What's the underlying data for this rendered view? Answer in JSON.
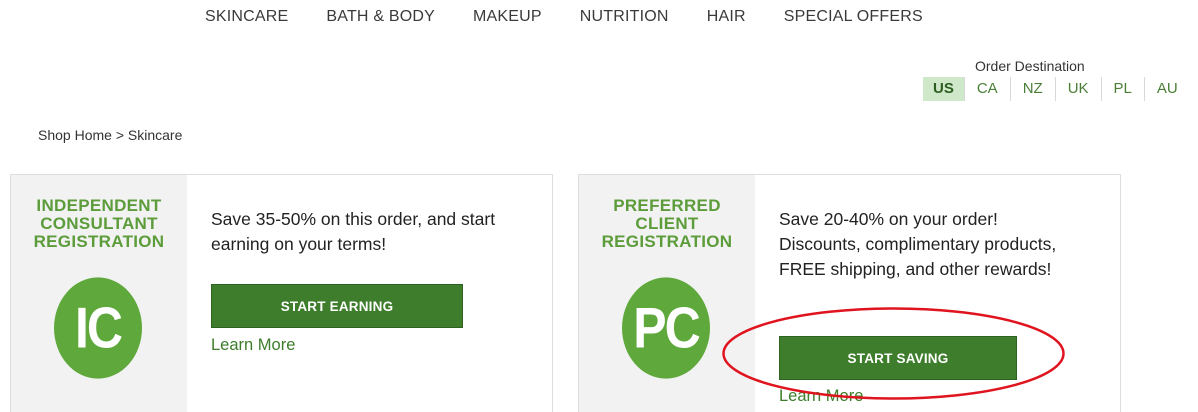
{
  "nav": {
    "items": [
      "SKINCARE",
      "BATH & BODY",
      "MAKEUP",
      "NUTRITION",
      "HAIR",
      "SPECIAL OFFERS"
    ]
  },
  "destination": {
    "label": "Order Destination",
    "options": [
      "US",
      "CA",
      "NZ",
      "UK",
      "PL",
      "AU"
    ],
    "selected": "US"
  },
  "breadcrumb": {
    "home": "Shop Home",
    "separator": " > ",
    "current": "Skincare"
  },
  "cards": [
    {
      "title": "INDEPENDENT\nCONSULTANT\nREGISTRATION",
      "badge": "IC",
      "text": "Save 35-50% on this order, and start earning on your terms!",
      "button": "START EARNING",
      "learn_more": "Learn More"
    },
    {
      "title": "PREFERRED\nCLIENT\nREGISTRATION",
      "badge": "PC",
      "text": "Save 20-40% on your order! Discounts, complimentary products, FREE shipping, and other rewards!",
      "button": "START SAVING",
      "learn_more": "Learn More"
    }
  ],
  "colors": {
    "brand_green": "#3d7d2b",
    "title_green": "#5c9c3a",
    "badge_green": "#5fa83b",
    "selected_bg": "#cfe8c9",
    "annotation_red": "#e0141e"
  }
}
